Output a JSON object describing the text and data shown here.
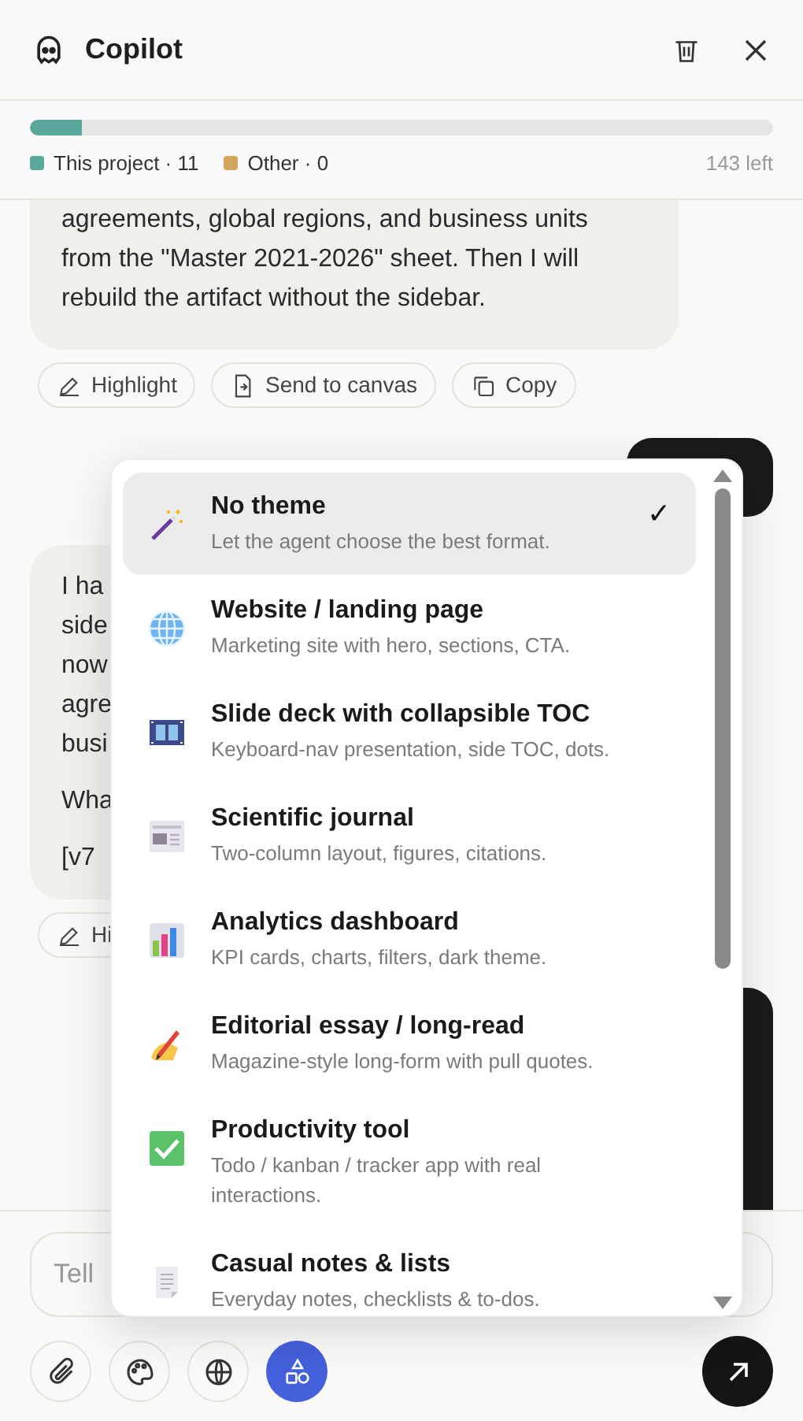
{
  "header": {
    "title": "Copilot"
  },
  "usage": {
    "level": 0.07,
    "legend": [
      {
        "label": "This project · 11",
        "color": "#5aa89b"
      },
      {
        "label": "Other · 0",
        "color": "#d2a55b"
      }
    ],
    "remaining": "143 left"
  },
  "messages": [
    {
      "kind": "assistant",
      "lines": [
        "agreements, global regions, and business units",
        "from the \"Master 2021-2026\" sheet. Then I will",
        "rebuild the artifact without the sidebar."
      ],
      "actions": [
        "Highlight",
        "Send to canvas",
        "Copy"
      ]
    },
    {
      "kind": "user"
    },
    {
      "kind": "assistant",
      "paragraphs": [
        [
          "I ha",
          "side",
          "now",
          "agre",
          "busi"
        ],
        [
          "Wha"
        ],
        [
          "[v7"
        ]
      ],
      "actions": [
        "Hi"
      ]
    },
    {
      "kind": "user"
    }
  ],
  "composer": {
    "placeholder": "Tell",
    "tools": [
      {
        "selected": false
      },
      {
        "selected": false
      },
      {
        "selected": false
      },
      {
        "selected": true
      }
    ]
  },
  "theme_menu": {
    "items": [
      {
        "title": "No theme",
        "description": "Let the agent choose the best format.",
        "selected": true
      },
      {
        "title": "Website / landing page",
        "description": "Marketing site with hero, sections, CTA.",
        "selected": false
      },
      {
        "title": "Slide deck with collapsible TOC",
        "description": "Keyboard-nav presentation, side TOC, dots.",
        "selected": false
      },
      {
        "title": "Scientific journal",
        "description": "Two-column layout, figures, citations.",
        "selected": false
      },
      {
        "title": "Analytics dashboard",
        "description": "KPI cards, charts, filters, dark theme.",
        "selected": false
      },
      {
        "title": "Editorial essay / long-read",
        "description": "Magazine-style long-form with pull quotes.",
        "selected": false
      },
      {
        "title": "Productivity tool",
        "description": "Todo / kanban / tracker app with real interactions.",
        "selected": false
      },
      {
        "title": "Casual notes & lists",
        "description": "Everyday notes, checklists & to-dos.",
        "selected": false
      }
    ],
    "check": "✓"
  }
}
